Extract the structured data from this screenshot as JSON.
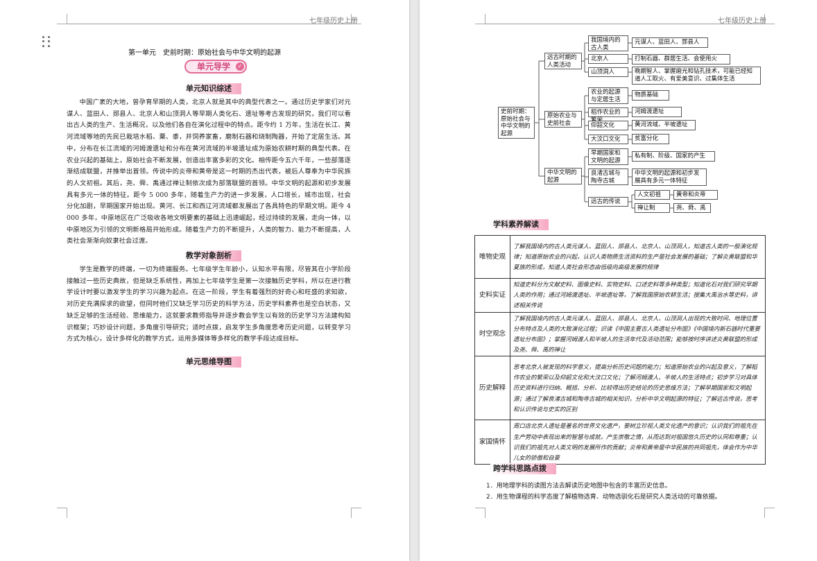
{
  "header": {
    "left_page": "七年级历史上册",
    "right_page": "七年级历史上册"
  },
  "unit_title": "第一单元　史前时期：原始社会与中华文明的起源",
  "guide_banner": "单元导学",
  "sections": {
    "knowledge": "单元知识综述",
    "teaching": "教学对象剖析",
    "mindmap": "单元思维导图",
    "literacy": "学科素养解读",
    "cross": "跨学科思路点拨"
  },
  "knowledge_text": "中国广袤的大地，曾孕育早期的人类，北京人就是其中的典型代表之一。通过历史学家们对元谋人、蓝田人、郧县人、北京人和山顶洞人等早期人类化石、遗址等考古发现的研究，我们可以看出古人类的生产、生活概况，以及他们各自在演化过程中的特点。距今约 1 万年，生活在长江、黄河流域等地的先民已栽培水稻、粟、黍，并饲养家畜，磨制石器和烧制陶器，开始了定居生活。其中，分布在长江流域的河姆渡遗址和分布在黄河流域的半坡遗址成为原始农耕时期的典型代表。在农业兴起的基础上，原始社会不断发展，创造出丰富多彩的文化。相传距今五六千年，一些部落逐渐结成联盟，并推举出首领。传说中的炎帝和黄帝是这一时期的杰出代表，被后人尊奉为中华民族的人文初祖。其后，尧、舜、禹通过禅让制依次成为部落联盟的首领。中华文明的起源和初步发展具有多元一体的特征。距今 5 000 多年，随着生产力的进一步发展，人口增长，城市出现，社会分化加剧，早期国家开始出现。黄河、长江和西辽河流域都发展出了各具特色的早期文明。距今 4 000 多年，中原地区在广泛吸收各地文明要素的基础上迅速崛起，经过持续的发展，走向一体，以中原地区为引领的文明新格局开始形成。随着生产力的不断提升，人类的智力、能力不断提高，人类社会渐渐向奴隶社会过渡。",
  "teaching_text": "学生是教学的终端，一切为终端服务。七年级学生年龄小，认知水平有限，尽管其在小学阶段接触过一些历史典故，但是缺乏系统性，再加上七年级学生是第一次接触历史学科，所以在进行教学设计时要以激发学生的学习兴趣为起点。在这一阶段，学生有着强烈的好奇心和旺盛的求知欲，对历史充满探求的欲望，但同时他们又缺乏学习历史的科学方法，历史学科素养也是空白状态，又缺乏足够的生活经验、思维能力，这就要求教师指导并逐步教会学生以有效的历史学习方法建构知识框架；巧妙设计问题，多角度引导研究；适时点拨，启发学生多角度思考历史问题，以转变学习方式为核心，设计多样化的教学方式，运用多媒体等多样化的教学手段达成目标。",
  "mindmap": {
    "root": "史前时期：原始社会与中华文明的起源",
    "branches": [
      {
        "label": "远古时期的人类活动",
        "children": [
          {
            "label": "我国境内的古人类",
            "leaf": "元谋人、蓝田人、郧县人"
          },
          {
            "label": "北京人",
            "leaf": "打制石器、群居生活、会使用火"
          },
          {
            "label": "山顶洞人",
            "leaf": "晚期智人、掌握磨光和钻孔技术，可能已经知道人工取火、有爱美意识、过集体生活"
          }
        ]
      },
      {
        "label": "原始农业与史前社会",
        "children": [
          {
            "label": "农业的起源与定居生活",
            "leaf": "物质基础"
          },
          {
            "label": "稻作农业的繁荣",
            "leaf": "河姆渡遗址"
          },
          {
            "label": "仰韶文化",
            "leaf": "黄河流域、半坡遗址"
          },
          {
            "label": "大汶口文化",
            "leaf": "贫富分化"
          }
        ]
      },
      {
        "label": "中华文明的起源",
        "children": [
          {
            "label": "早期国家和文明的起源",
            "leaf": "私有制、阶级、国家的产生"
          },
          {
            "label": "良渚古城与陶寺古城",
            "leaf": "中华文明的起源和初步发展具有多元一体特征"
          },
          {
            "label": "远古的传说",
            "subs": [
              {
                "label": "人文初祖",
                "leaf": "黄帝和炎帝"
              },
              {
                "label": "禅让制",
                "leaf": "尧、舜、禹"
              }
            ]
          }
        ]
      }
    ]
  },
  "literacy_table": [
    {
      "key": "唯物史观",
      "value": "了解我国境内的古人类元谋人、蓝田人、郧县人、北京人、山顶洞人，知道古人类的一般演化规律；知道原始农业的兴起，认识人类物质生活资料的生产是社会发展的基础；了解炎黄联盟和华夏族的形成，知道人类社会形态由低级向高级发展的规律"
    },
    {
      "key": "史料实证",
      "value": "知道史料分为文献史料、图像史料、实物史料、口述史料等多种类型；知道化石对我们研究早期人类的作用；通过河姆渡遗址、半坡遗址等，了解我国原始农耕生活；搜集大禹治水等史料，讲述相关传说"
    },
    {
      "key": "时空观念",
      "value": "了解我国境内的古人类元谋人、蓝田人、郧县人、北京人、山顶洞人出现的大致时间、地理位置分布特点及人类的大致演化过程；识读《中国主要古人类遗址分布图》《中国境内新石器时代重要遗址分布图》；掌握河姆渡人和半坡人的生活年代及活动范围；能够按时序讲述炎黄联盟的形成及尧、舜、禹的禅让"
    },
    {
      "key": "历史解释",
      "value": "思考北京人被发现的科学意义，提高分析历史问题的能力；知道原始农业的兴起及意义，了解稻作农业的繁荣以及仰韶文化和大汶口文化；了解河姆渡人、半坡人的生活特点；初步学习对具体历史资料进行归纳、概括、分析、比较得出历史结论的历史思维方法；了解早期国家和文明起源；通过了解良渚古城和陶寺古城的相关知识，分析中华文明起源的特征；了解远古传说，思考和认识传说与史实的区别"
    },
    {
      "key": "家国情怀",
      "value": "周口店北京人遗址是著名的世界文化遗产，要树立珍视人类文化遗产的意识；认识我们的祖先在生产劳动中表现出来的智慧与成就，产生崇敬之情，从而达到对祖国悠久历史的认同和尊重；认识我们的祖先对人类文明的发展所作的贡献；炎帝和黄帝是中华民族的共同祖先，体会作为中华儿女的骄傲和自豪"
    }
  ],
  "cross_notes": [
    "1．用地理学科的读图方法去解读历史地图中包含的丰富历史信息。",
    "2．用生物课程的科学态度了解植物选育、动物选驯化石是研究人类活动的可靠依据。"
  ],
  "colors": {
    "accent": "#e36b96",
    "banner_bg": "#fde6ef",
    "header_rule": "#9a9a9a"
  }
}
